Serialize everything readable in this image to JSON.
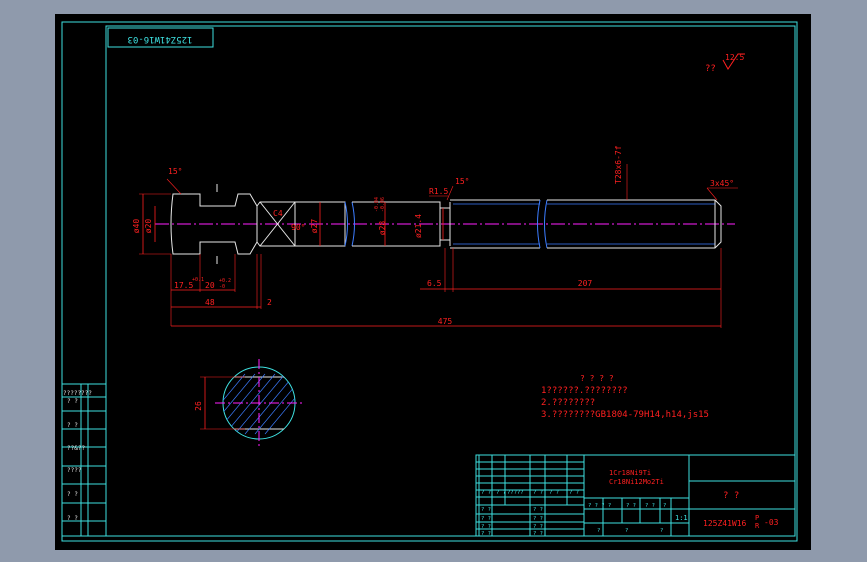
{
  "drawing": {
    "number_mirrored": "125Z41W16-03",
    "roughness_mark": "??",
    "roughness_value": "12.5",
    "chamfer_note": "3x45°",
    "notes_title": "? ? ? ?",
    "notes": [
      "1??????.????????",
      "2.????????",
      "3.????????GB1804-79H14,h14,js15"
    ]
  },
  "dimensions": {
    "d40": "ø40",
    "d20": "ø20",
    "d27": "ø27",
    "d28": "ø28",
    "d28_tol_up": "-0.04",
    "d28_tol_dn": "-0.06",
    "d21_4": "ø21.4",
    "r1_5": "R1.5",
    "angle_15a": "15°",
    "angle_15b": "15°",
    "angle_90": "90°",
    "c4": "C4",
    "thread": "T28x6-7f",
    "l17_5": "17.5",
    "l17_5_tol": "+0.1",
    "l20": "20",
    "l20_tol_up": "+0.2",
    "l20_tol_dn": "-0",
    "l48": "48",
    "l2": "2",
    "l475": "475",
    "l6_5": "6.5",
    "l207": "207",
    "section_26": "26"
  },
  "title_block": {
    "material_1": "1Cr18Ni9Ti",
    "material_2": "Cr18Ni12Mo2Ti",
    "name": "? ?",
    "number": "125Z41W16",
    "number_suffix_top": "P",
    "number_suffix_bottom": "R",
    "number_end": "-03",
    "scale": "1:1",
    "cells_q2": "? ?",
    "cells_q1": "?",
    "cells_q3": "?????",
    "cells_q4": "? ? ? ?"
  },
  "side_column": {
    "labels": [
      "????????",
      "?   ?",
      "?   ?",
      "??&??",
      "????",
      "?   ?",
      "?   ?"
    ]
  }
}
